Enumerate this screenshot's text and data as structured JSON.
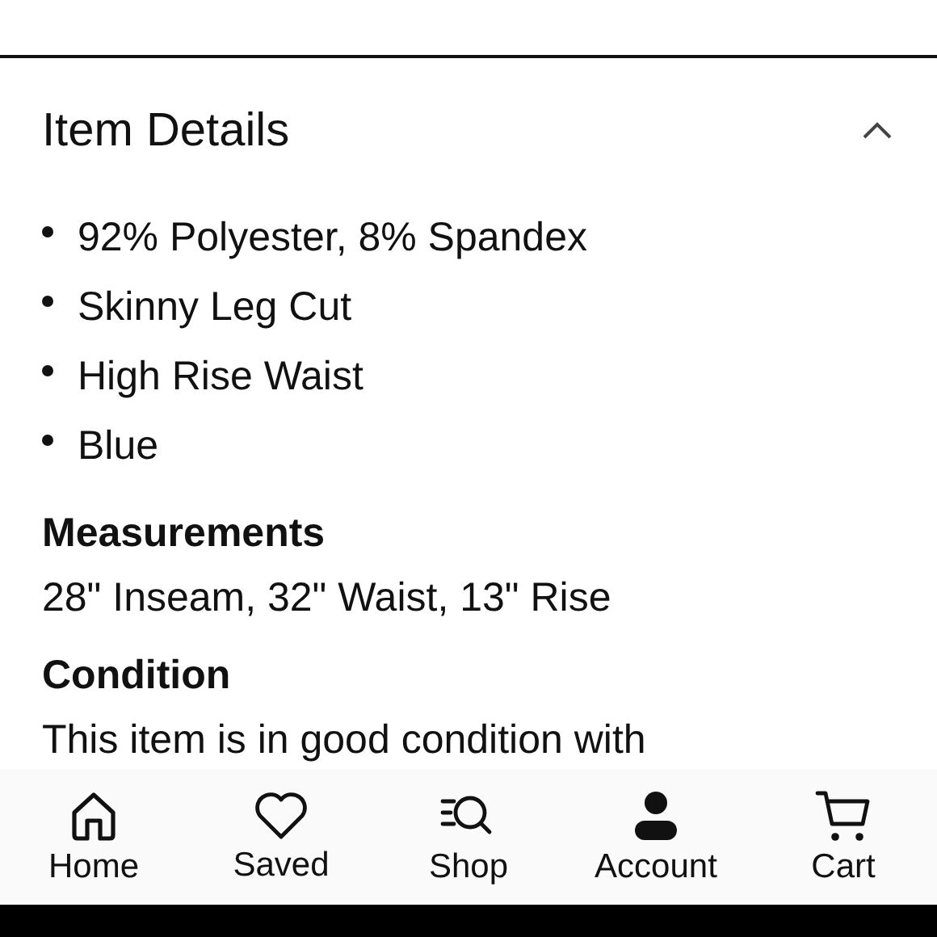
{
  "section": {
    "title": "Item Details",
    "expanded": true
  },
  "bullets": [
    "92% Polyester, 8% Spandex",
    "Skinny Leg Cut",
    "High Rise Waist",
    "Blue"
  ],
  "details": [
    {
      "heading": "Measurements",
      "text": "28\" Inseam, 32\" Waist, 13\" Rise"
    },
    {
      "heading": "Condition",
      "text": "This item is in good condition with"
    }
  ],
  "nav": [
    {
      "label": "Home",
      "kind": "home"
    },
    {
      "label": "Saved",
      "kind": "saved"
    },
    {
      "label": "Shop",
      "kind": "shop"
    },
    {
      "label": "Account",
      "kind": "account"
    },
    {
      "label": "Cart",
      "kind": "cart"
    }
  ]
}
